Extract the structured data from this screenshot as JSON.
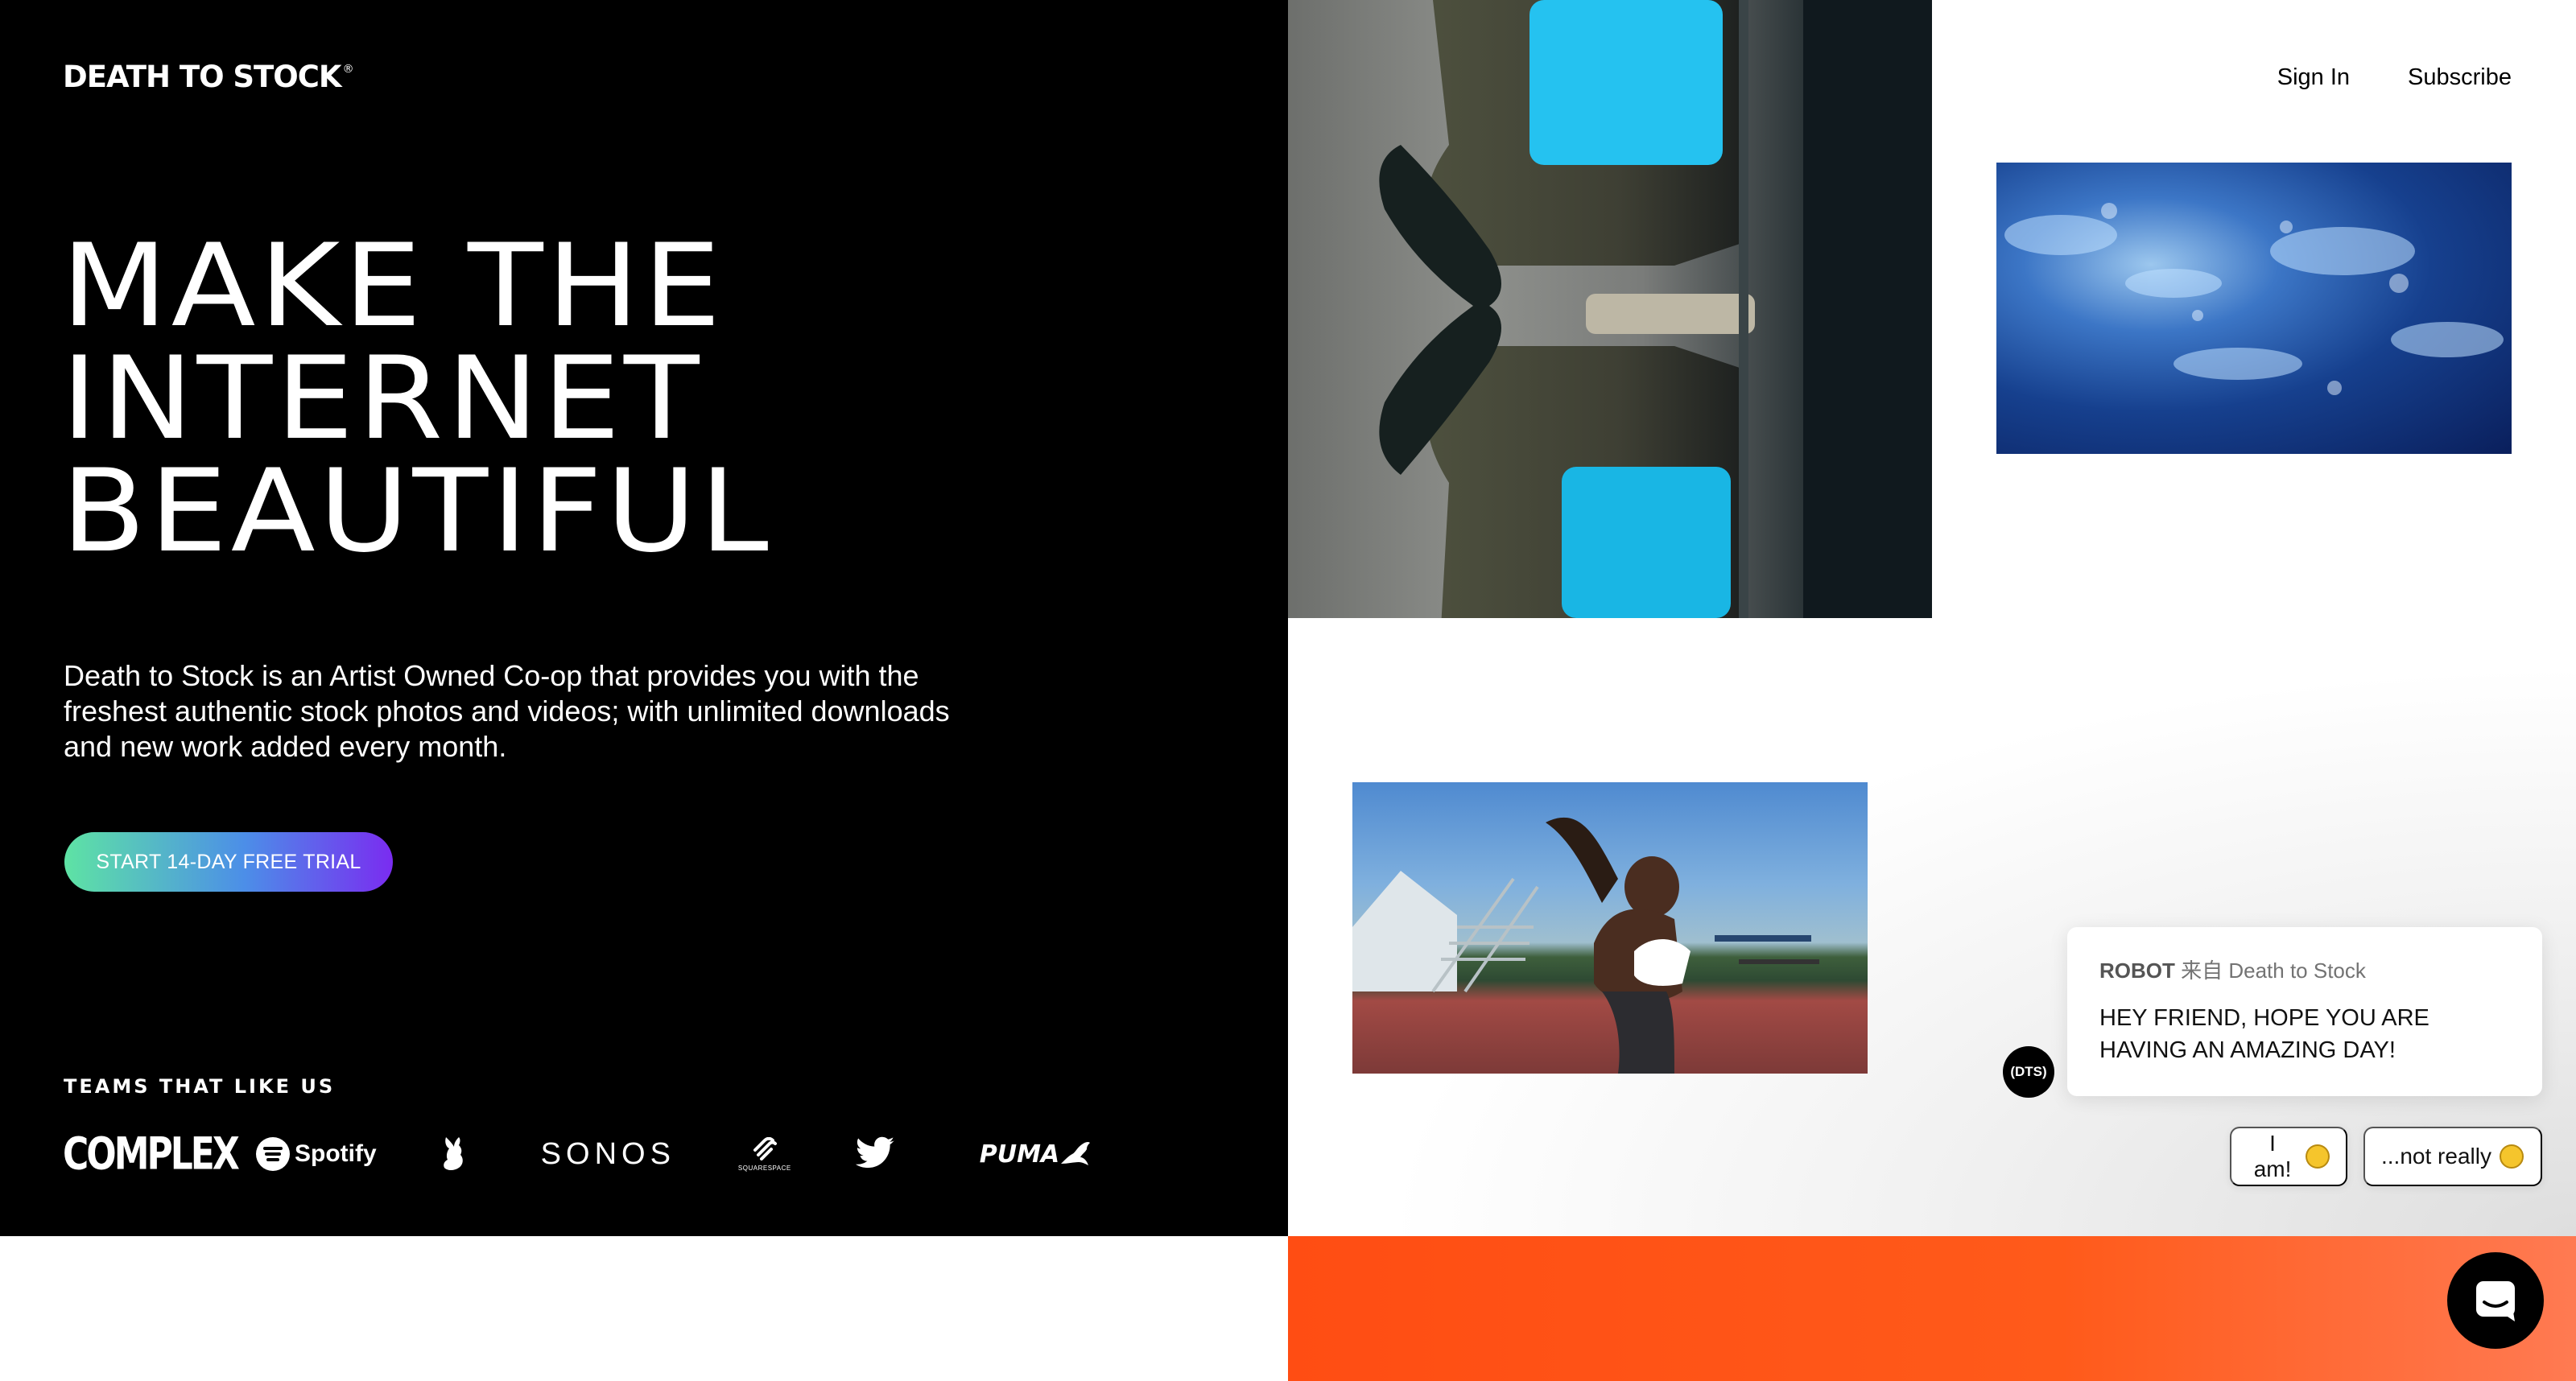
{
  "brand": {
    "logo_text": "DEATH TO STOCK",
    "logo_mark": "®"
  },
  "nav": {
    "sign_in": "Sign In",
    "subscribe": "Subscribe"
  },
  "hero": {
    "headline_lines": [
      "MAKE THE",
      "INTERNET",
      "BEAUTIFUL"
    ],
    "intro": "Death to Stock is an Artist Owned Co-op that provides you with the freshest authentic stock photos and videos; with unlimited downloads and new work added every month.",
    "cta_label": "START 14-DAY FREE TRIAL",
    "cta_colors": [
      "#5ee3a4",
      "#4c8ee8",
      "#7a2cf0"
    ]
  },
  "teams": {
    "title": "TEAMS THAT LIKE US",
    "logos": [
      {
        "name": "complex-logo",
        "text": "COMPLEX"
      },
      {
        "name": "spotify-logo",
        "text": "Spotify"
      },
      {
        "name": "playboy-logo",
        "text": ""
      },
      {
        "name": "sonos-logo",
        "text": "SONOS"
      },
      {
        "name": "squarespace-logo",
        "text": "SQUARESPACE"
      },
      {
        "name": "twitter-logo",
        "text": ""
      },
      {
        "name": "puma-logo",
        "text": "PUMA"
      }
    ]
  },
  "chat": {
    "sender_name": "ROBOT",
    "sender_from": "来自 Death to Stock",
    "message": "HEY FRIEND, HOPE YOU ARE HAVING AN AMAZING DAY!",
    "avatar_text": "(DTS)",
    "replies": [
      {
        "label": "I am!",
        "emoji": "grinning-face"
      },
      {
        "label": "...not really",
        "emoji": "crying-face"
      }
    ]
  },
  "colors": {
    "hero_bg": "#000000",
    "accent_orange": "#ff4d13",
    "text_light": "#ffffff"
  },
  "icons": {
    "launcher": "chat-launcher-icon"
  }
}
